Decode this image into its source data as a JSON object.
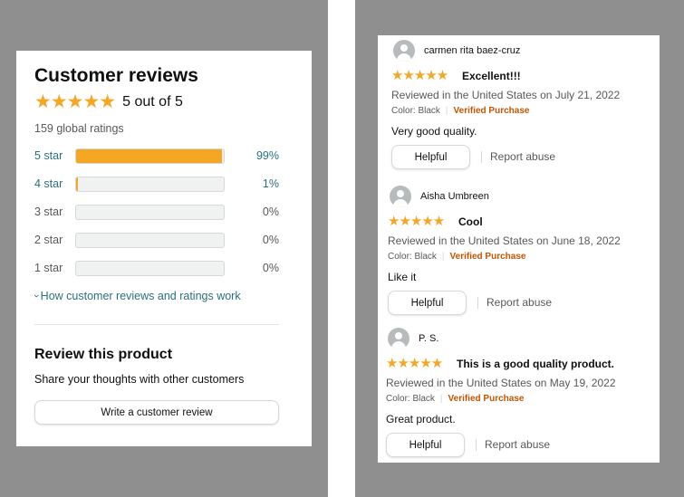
{
  "summary": {
    "title": "Customer reviews",
    "stars": "★★★★★",
    "rating_text": "5 out of 5",
    "global_ratings": "159 global ratings",
    "histogram": [
      {
        "label": "5 star",
        "percent_text": "99%",
        "value": 99
      },
      {
        "label": "4 star",
        "percent_text": "1%",
        "value": 1
      },
      {
        "label": "3 star",
        "percent_text": "0%",
        "value": 0
      },
      {
        "label": "2 star",
        "percent_text": "0%",
        "value": 0
      },
      {
        "label": "1 star",
        "percent_text": "0%",
        "value": 0
      }
    ],
    "how_link_chevron": "›",
    "how_link": "How customer reviews and ratings work",
    "review_product_title": "Review this product",
    "review_product_sub": "Share your thoughts with other customers",
    "write_review_button": "Write a customer review"
  },
  "reviews": [
    {
      "name": "carmen rita baez-cruz",
      "stars": "★★★★★",
      "title": "Excellent!!!",
      "meta": "Reviewed in the United States on July 21, 2022",
      "color": "Color: Black",
      "verified": "Verified Purchase",
      "body": "Very good quality.",
      "helpful": "Helpful",
      "report": "Report abuse"
    },
    {
      "name": "Aisha Umbreen",
      "stars": "★★★★★",
      "title": "Cool",
      "meta": "Reviewed in the United States on June 18, 2022",
      "color": "Color: Black",
      "verified": "Verified Purchase",
      "body": "Like it",
      "helpful": "Helpful",
      "report": "Report abuse"
    },
    {
      "name": "P. S.",
      "stars": "★★★★★",
      "title": "This is a good quality product.",
      "meta": "Reviewed in the United States on May 19, 2022",
      "color": "Color: Black",
      "verified": "Verified Purchase",
      "body": "Great product.",
      "helpful": "Helpful",
      "report": "Report abuse"
    }
  ],
  "colors": {
    "star": "#f5a623",
    "link": "#2a6f7d",
    "verified": "#c45500",
    "backdrop": "#8f8f8f"
  }
}
